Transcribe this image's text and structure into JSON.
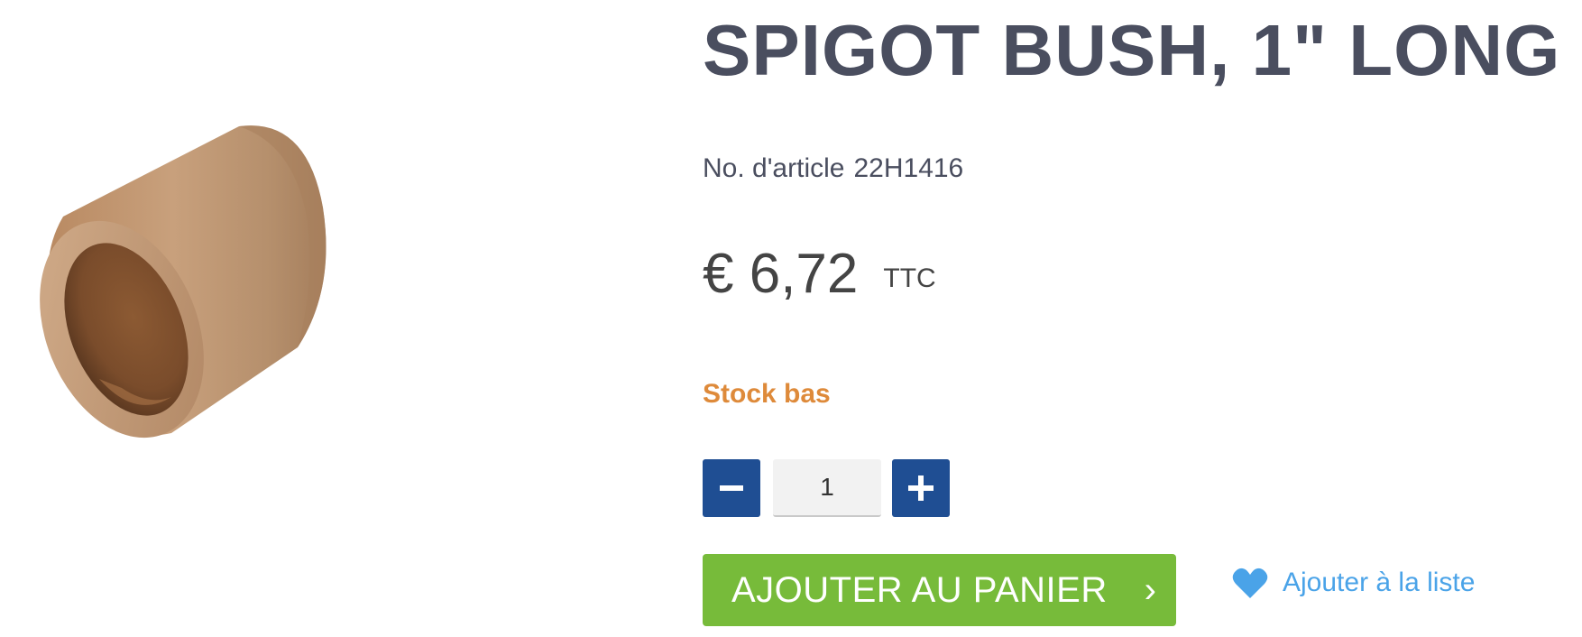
{
  "product": {
    "title": "SPIGOT BUSH, 1\" LONG",
    "article_label": "No. d'article",
    "article_number": "22H1416",
    "price": "€ 6,72",
    "price_suffix": "TTC",
    "stock_status": "Stock bas",
    "image_icon": "bronze-bushing-image"
  },
  "quantity": {
    "value": "1",
    "minus_icon": "minus-icon",
    "plus_icon": "plus-icon"
  },
  "actions": {
    "add_to_cart_label": "AJOUTER AU PANIER",
    "add_to_cart_chevron": "›",
    "wishlist_label": "Ajouter à la liste",
    "wishlist_icon": "heart-icon"
  },
  "colors": {
    "title": "#4a4e5f",
    "stock": "#de8a3a",
    "qty_button": "#1f4e93",
    "cart_button": "#77bb3a",
    "wishlist": "#4aa3e8"
  }
}
